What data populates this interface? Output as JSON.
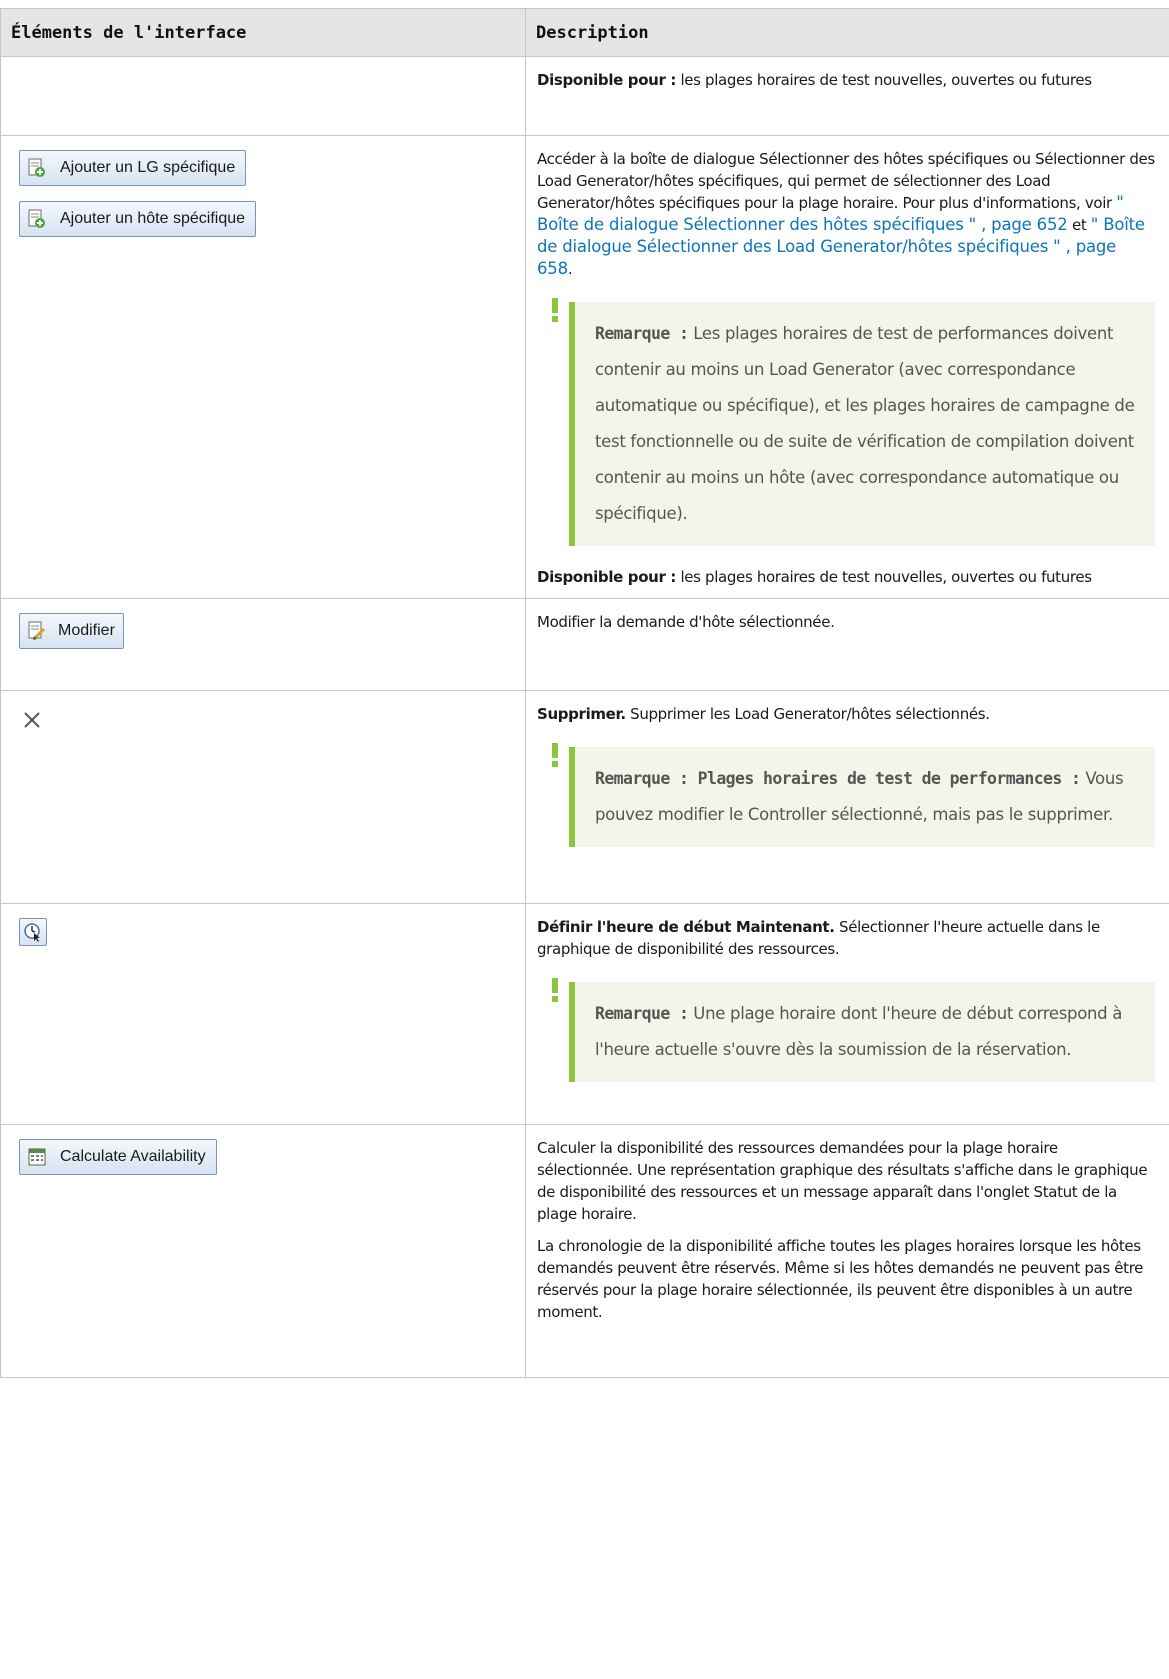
{
  "header": {
    "col1": "Éléments de l'interface",
    "col2": "Description"
  },
  "rows": [
    {
      "desc_bold": "Disponible pour :",
      "desc_text": " les plages horaires de test nouvelles, ouvertes ou futures"
    },
    {
      "button1": "Ajouter un LG spécifique",
      "button2": "Ajouter un hôte spécifique",
      "desc_pre": "Accéder à la boîte de dialogue Sélectionner des hôtes spécifiques ou Sélectionner des Load Generator/hôtes spécifiques, qui permet de sélectionner des Load Generator/hôtes spécifiques pour la plage horaire. Pour plus d'informations, voir ",
      "link1": "\" Boîte de dialogue Sélectionner des hôtes spécifiques \" , page 652",
      "desc_mid": " et ",
      "link2": "\" Boîte de dialogue Sélectionner des Load Generator/hôtes spécifiques \" , page 658",
      "desc_end": ".",
      "note_bold": "Remarque :",
      "note_text": " Les plages horaires de test de performances doivent contenir au moins un Load Generator (avec correspondance automatique ou spécifique), et les plages horaires de campagne de test fonctionnelle ou de suite de vérification de compilation doivent contenir au moins un hôte (avec correspondance automatique ou spécifique).",
      "avail_bold": "Disponible pour :",
      "avail_text": " les plages horaires de test nouvelles, ouvertes ou futures"
    },
    {
      "button": "Modifier",
      "desc_text": "Modifier la demande d'hôte sélectionnée."
    },
    {
      "icon": "close-icon",
      "desc_bold": "Supprimer.",
      "desc_text": " Supprimer les Load Generator/hôtes sélectionnés.",
      "note_bold": "Remarque : Plages horaires de test de performances :",
      "note_text": " Vous pouvez modifier le Controller sélectionné, mais pas le supprimer."
    },
    {
      "icon": "clock-cursor-icon",
      "desc_bold": "Définir l'heure de début Maintenant.",
      "desc_text": " Sélectionner l'heure actuelle dans le graphique de disponibilité des ressources.",
      "note_bold": "Remarque :",
      "note_text": " Une plage horaire dont l'heure de début correspond à l'heure actuelle s'ouvre dès la soumission de la réservation."
    },
    {
      "button": "Calculate Availability",
      "para1": "Calculer la disponibilité des ressources demandées pour la plage horaire sélectionnée. Une représentation graphique des résultats s'affiche dans le graphique de disponibilité des ressources et un message apparaît dans l'onglet Statut de la plage horaire.",
      "para2": "La chronologie de la disponibilité affiche toutes les plages horaires lorsque les hôtes demandés peuvent être réservés. Même si les hôtes demandés ne peuvent pas être réservés pour la plage horaire sélectionnée, ils peuvent être disponibles à un autre moment."
    }
  ],
  "colors": {
    "link": "#0f74b8",
    "note_border": "#8cc63f",
    "note_bg": "#f1f6e8",
    "header_bg": "#e5e5e5"
  }
}
